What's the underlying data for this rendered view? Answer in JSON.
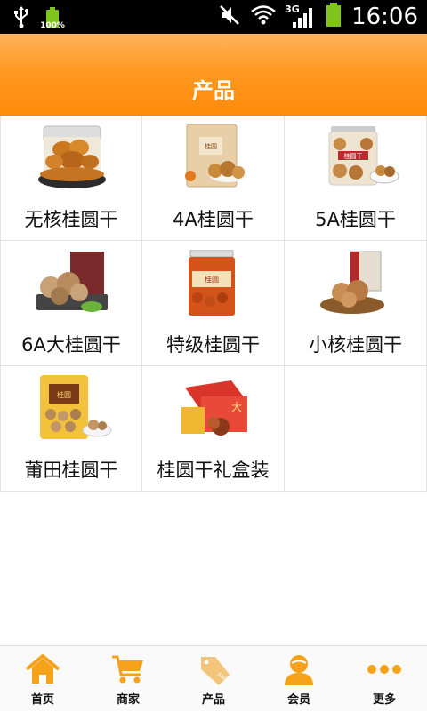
{
  "status_bar": {
    "battery_percent": "100%",
    "network": "3G",
    "time": "16:06"
  },
  "header": {
    "title": "产品"
  },
  "products": [
    {
      "label": "无核桂圆干"
    },
    {
      "label": "4A桂圆干"
    },
    {
      "label": "5A桂圆干"
    },
    {
      "label": "6A大桂圆干"
    },
    {
      "label": "特级桂圆干"
    },
    {
      "label": "小核桂圆干"
    },
    {
      "label": "莆田桂圆干"
    },
    {
      "label": "桂圆干礼盒装"
    }
  ],
  "tabbar": {
    "items": [
      {
        "label": "首页",
        "icon": "home-icon"
      },
      {
        "label": "商家",
        "icon": "cart-icon"
      },
      {
        "label": "产品",
        "icon": "tag-icon"
      },
      {
        "label": "会员",
        "icon": "user-icon"
      },
      {
        "label": "更多",
        "icon": "more-icon"
      }
    ]
  },
  "colors": {
    "header_orange": "#ff9a22",
    "tab_icon_orange": "#f7a21b",
    "status_green": "#7fc31d"
  }
}
